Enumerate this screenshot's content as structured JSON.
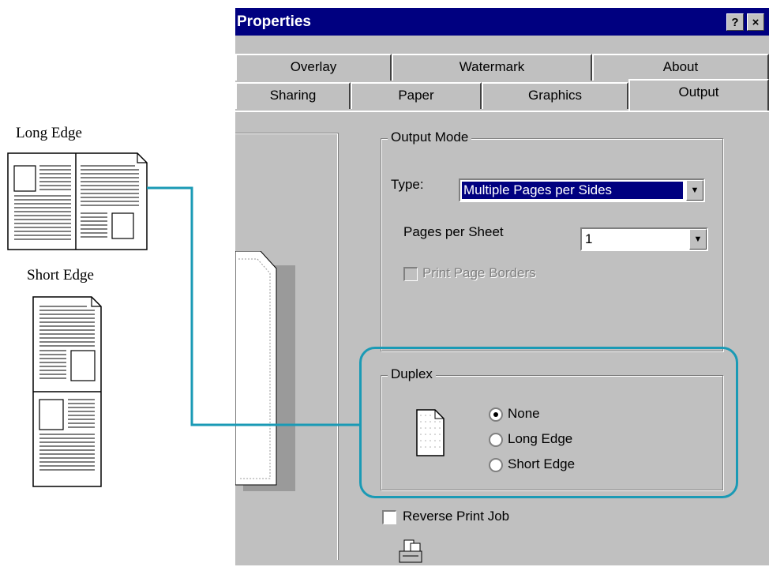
{
  "diagram": {
    "long_edge_label": "Long Edge",
    "short_edge_label": "Short Edge",
    "connector_color": "#1a9ab5"
  },
  "dialog": {
    "title": "Properties",
    "help_button": "?",
    "close_button": "×",
    "tabs_back_row": [
      "Overlay",
      "Watermark",
      "About"
    ],
    "tabs_front_row": [
      "Sharing",
      "Paper",
      "Graphics"
    ],
    "tab_selected": "Output",
    "output_mode": {
      "legend": "Output Mode",
      "type_label": "Type:",
      "type_value": "Multiple Pages per Sides",
      "pages_per_sheet_label": "Pages per Sheet",
      "pages_per_sheet_value": "1",
      "print_page_borders_label": "Print Page Borders"
    },
    "duplex": {
      "legend": "Duplex",
      "options": [
        "None",
        "Long Edge",
        "Short Edge"
      ],
      "selected": "None"
    },
    "reverse_print_job_label": "Reverse Print Job"
  }
}
